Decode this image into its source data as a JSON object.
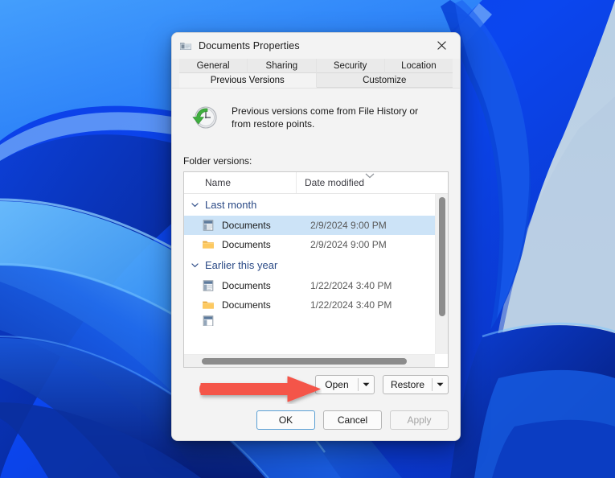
{
  "window": {
    "title": "Documents Properties",
    "icon": "folder-properties-icon",
    "close_label": "✕"
  },
  "tabs": {
    "row1": [
      {
        "label": "General",
        "selected": false
      },
      {
        "label": "Sharing",
        "selected": false
      },
      {
        "label": "Security",
        "selected": false
      },
      {
        "label": "Location",
        "selected": false
      }
    ],
    "row2": [
      {
        "label": "Previous Versions",
        "selected": true
      },
      {
        "label": "Customize",
        "selected": false
      }
    ]
  },
  "info": {
    "icon": "clock-restore-icon",
    "text": "Previous versions come from File History or from restore points."
  },
  "list": {
    "section_label": "Folder versions:",
    "columns": [
      {
        "key": "name",
        "label": "Name"
      },
      {
        "key": "date",
        "label": "Date modified",
        "sorted": true,
        "sort_dir": "asc"
      }
    ],
    "groups": [
      {
        "label": "Last month",
        "expanded": true,
        "rows": [
          {
            "icon": "document-file-icon",
            "name": "Documents",
            "date": "2/9/2024 9:00 PM",
            "selected": true
          },
          {
            "icon": "folder-icon",
            "name": "Documents",
            "date": "2/9/2024 9:00 PM",
            "selected": false
          }
        ]
      },
      {
        "label": "Earlier this year",
        "expanded": true,
        "rows": [
          {
            "icon": "document-file-icon",
            "name": "Documents",
            "date": "1/22/2024 3:40 PM",
            "selected": false
          },
          {
            "icon": "folder-icon",
            "name": "Documents",
            "date": "1/22/2024 3:40 PM",
            "selected": false
          }
        ]
      }
    ]
  },
  "actions": {
    "open": {
      "label": "Open",
      "dropdown": true,
      "enabled": true
    },
    "restore": {
      "label": "Restore",
      "dropdown": true,
      "enabled": true
    }
  },
  "footer": {
    "ok": {
      "label": "OK",
      "default": true
    },
    "cancel": {
      "label": "Cancel",
      "default": false
    },
    "apply": {
      "label": "Apply",
      "disabled": true
    }
  },
  "annotation": {
    "type": "arrow",
    "direction": "right",
    "color": "#f4544a",
    "points_at": "Open"
  },
  "colors": {
    "accent": "#0a43e8",
    "selection": "#cce3f7",
    "group_header_text": "#2b4a86",
    "annotation_red": "#f4544a",
    "dialog_bg": "#f3f3f3"
  }
}
